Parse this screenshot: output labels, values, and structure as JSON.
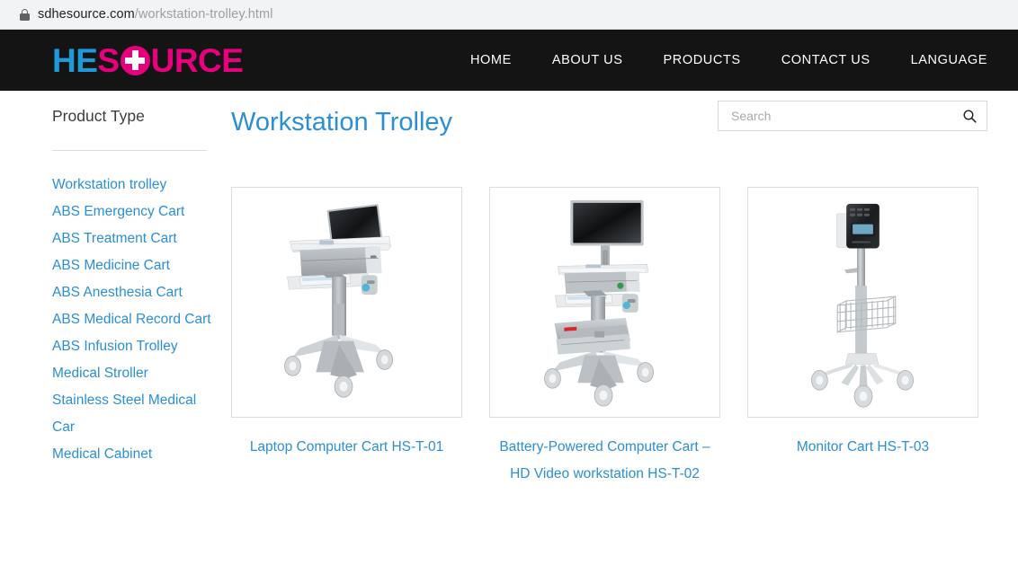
{
  "browser": {
    "url_host": "sdhesource.com",
    "url_path": "/workstation-trolley.html",
    "lock_icon": "lock-icon"
  },
  "header": {
    "logo": {
      "part1": "HE",
      "part2": "S",
      "part3": "URCE",
      "cross_icon": "medical-cross-icon"
    },
    "nav": [
      {
        "label": "HOME"
      },
      {
        "label": "ABOUT US"
      },
      {
        "label": "PRODUCTS"
      },
      {
        "label": "CONTACT US"
      },
      {
        "label": "LANGUAGE"
      }
    ]
  },
  "sidebar": {
    "title": "Product Type",
    "items": [
      {
        "label": "Workstation trolley"
      },
      {
        "label": "ABS Emergency Cart"
      },
      {
        "label": "ABS Treatment Cart"
      },
      {
        "label": "ABS Medicine Cart"
      },
      {
        "label": "ABS Anesthesia Cart"
      },
      {
        "label": "ABS Medical Record Cart"
      },
      {
        "label": "ABS Infusion Trolley"
      },
      {
        "label": "Medical Stroller"
      },
      {
        "label": "Stainless Steel Medical Car"
      },
      {
        "label": "Medical Cabinet"
      }
    ]
  },
  "search": {
    "placeholder": "Search",
    "value": "",
    "icon": "search-icon"
  },
  "main": {
    "title": "Workstation Trolley",
    "products": [
      {
        "caption": "Laptop Computer Cart HS-T-01",
        "image": "laptop-computer-cart-photo"
      },
      {
        "caption": "Battery-Powered Computer Cart – HD Video workstation HS-T-02",
        "image": "battery-powered-computer-cart-photo"
      },
      {
        "caption": "Monitor Cart HS-T-03",
        "image": "monitor-cart-photo"
      }
    ]
  },
  "colors": {
    "link_blue": "#2b8fd4",
    "header_black": "#141414",
    "logo_blue": "#1e9ada",
    "logo_magenta": "#e6007e",
    "border_gray": "#dddddd"
  }
}
